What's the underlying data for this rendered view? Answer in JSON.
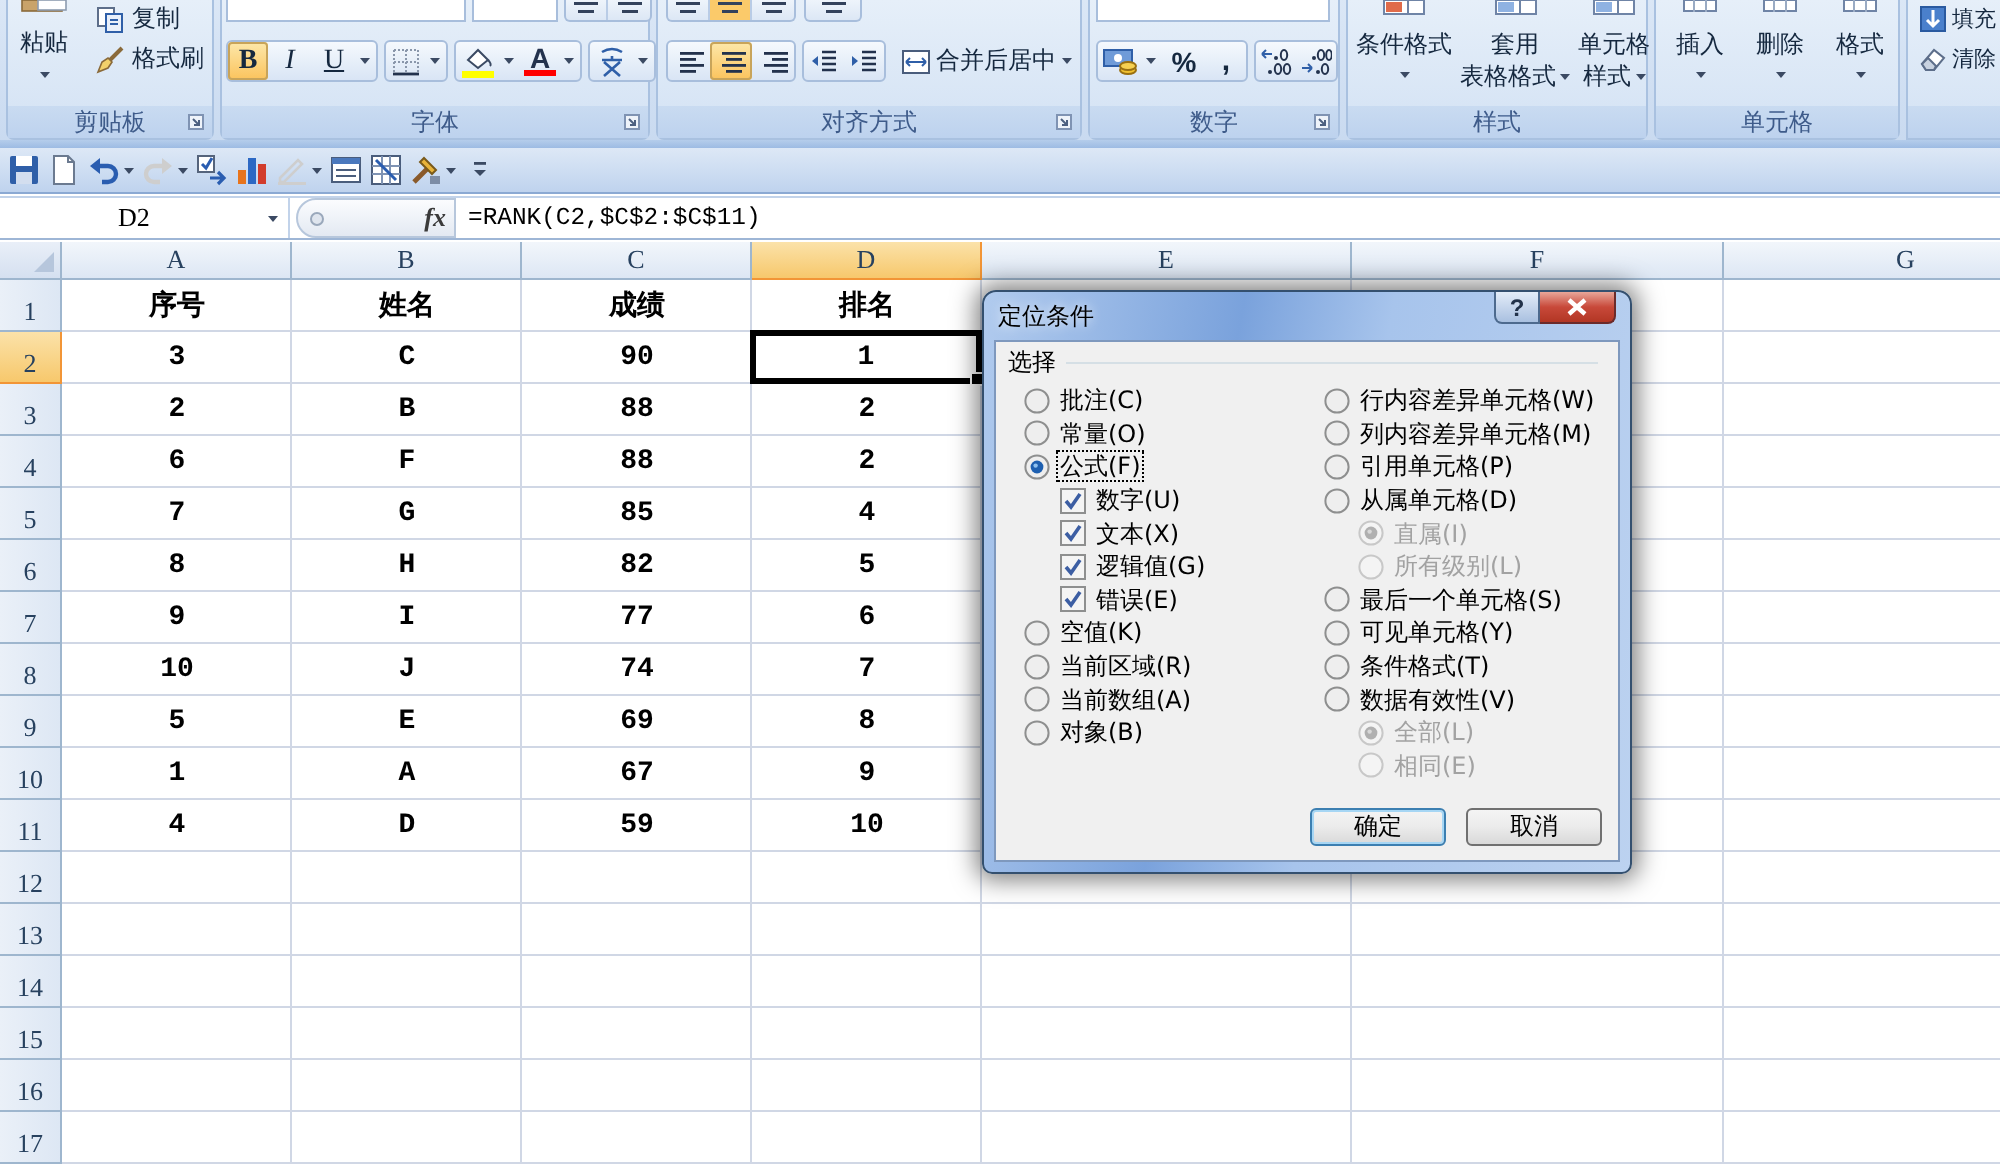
{
  "ribbon": {
    "groups": [
      {
        "kind": "clipboard",
        "label": "剪贴板",
        "paste": "粘贴",
        "copy": "复制",
        "format_painter": "格式刷"
      },
      {
        "kind": "font",
        "label": "字体",
        "buttons": [
          {
            "kind": "bold",
            "text": "B",
            "on": true
          },
          {
            "kind": "italic",
            "text": "I",
            "on": false
          },
          {
            "kind": "underline",
            "text": "U",
            "on": false
          }
        ],
        "font_color": "A"
      },
      {
        "kind": "alignment",
        "label": "对齐方式",
        "vertical": [
          {
            "selected": false
          },
          {
            "selected": true
          },
          {
            "selected": false
          }
        ],
        "horizontal": [
          {
            "kind": "left",
            "selected": false
          },
          {
            "kind": "center",
            "selected": true
          },
          {
            "kind": "right",
            "selected": false
          }
        ],
        "merge": "合并后居中"
      },
      {
        "kind": "number",
        "label": "数字",
        "percent": "%",
        "comma": ","
      },
      {
        "kind": "styles",
        "label": "样式",
        "buttons": [
          {
            "lines": [
              "条件格式"
            ]
          },
          {
            "lines": [
              "套用",
              "表格格式"
            ]
          },
          {
            "lines": [
              "单元格",
              "样式"
            ]
          }
        ]
      },
      {
        "kind": "cells",
        "label": "单元格",
        "buttons": [
          "插入",
          "删除",
          "格式"
        ]
      },
      {
        "kind": "editing",
        "buttons": [
          "填充",
          "清除"
        ]
      }
    ]
  },
  "quick_access": [
    {
      "kind": "save",
      "disabled": false,
      "menu": false
    },
    {
      "kind": "new",
      "disabled": false,
      "menu": false
    },
    {
      "kind": "undo",
      "disabled": false,
      "menu": true
    },
    {
      "kind": "redo",
      "disabled": true,
      "menu": true
    },
    {
      "kind": "check",
      "disabled": false,
      "menu": false
    },
    {
      "kind": "chart",
      "disabled": false,
      "menu": false
    },
    {
      "kind": "pen",
      "disabled": true,
      "menu": true
    },
    {
      "kind": "form",
      "disabled": false,
      "menu": false
    },
    {
      "kind": "grid",
      "disabled": false,
      "menu": false
    },
    {
      "kind": "tools",
      "disabled": false,
      "menu": true
    },
    {
      "kind": "customize",
      "disabled": false,
      "menu": false
    }
  ],
  "formula_bar": {
    "name_box": "D2",
    "fx": "fx",
    "formula": "=RANK(C2,$C$2:$C$11)"
  },
  "sheet": {
    "columns": [
      {
        "label": "A",
        "selected": false
      },
      {
        "label": "B",
        "selected": false
      },
      {
        "label": "C",
        "selected": false
      },
      {
        "label": "D",
        "selected": true
      },
      {
        "label": "E",
        "selected": false
      },
      {
        "label": "F",
        "selected": false
      },
      {
        "label": "G",
        "selected": false
      }
    ],
    "rows": [
      {
        "label": "1",
        "selected": false,
        "cells": [
          "序号",
          "姓名",
          "成绩",
          "排名"
        ]
      },
      {
        "label": "2",
        "selected": true,
        "cells": [
          "3",
          "C",
          "90",
          "1"
        ]
      },
      {
        "label": "3",
        "selected": false,
        "cells": [
          "2",
          "B",
          "88",
          "2"
        ]
      },
      {
        "label": "4",
        "selected": false,
        "cells": [
          "6",
          "F",
          "88",
          "2"
        ]
      },
      {
        "label": "5",
        "selected": false,
        "cells": [
          "7",
          "G",
          "85",
          "4"
        ]
      },
      {
        "label": "6",
        "selected": false,
        "cells": [
          "8",
          "H",
          "82",
          "5"
        ]
      },
      {
        "label": "7",
        "selected": false,
        "cells": [
          "9",
          "I",
          "77",
          "6"
        ]
      },
      {
        "label": "8",
        "selected": false,
        "cells": [
          "10",
          "J",
          "74",
          "7"
        ]
      },
      {
        "label": "9",
        "selected": false,
        "cells": [
          "5",
          "E",
          "69",
          "8"
        ]
      },
      {
        "label": "10",
        "selected": false,
        "cells": [
          "1",
          "A",
          "67",
          "9"
        ]
      },
      {
        "label": "11",
        "selected": false,
        "cells": [
          "4",
          "D",
          "59",
          "10"
        ]
      },
      {
        "label": "12",
        "selected": false
      },
      {
        "label": "13",
        "selected": false
      },
      {
        "label": "14",
        "selected": false
      },
      {
        "label": "15",
        "selected": false
      },
      {
        "label": "16",
        "selected": false
      },
      {
        "label": "17",
        "selected": false
      }
    ]
  },
  "dialog": {
    "title": "定位条件",
    "help": "?",
    "group_label": "选择",
    "left": [
      {
        "kind": "radio",
        "label": "批注(C)",
        "selected": false
      },
      {
        "kind": "radio",
        "label": "常量(O)",
        "selected": false
      },
      {
        "kind": "radio",
        "label": "公式(F)",
        "selected": true,
        "children": [
          {
            "kind": "checkbox",
            "label": "数字(U)",
            "checked": true
          },
          {
            "kind": "checkbox",
            "label": "文本(X)",
            "checked": true
          },
          {
            "kind": "checkbox",
            "label": "逻辑值(G)",
            "checked": true
          },
          {
            "kind": "checkbox",
            "label": "错误(E)",
            "checked": true
          }
        ]
      },
      {
        "kind": "radio",
        "label": "空值(K)",
        "selected": false
      },
      {
        "kind": "radio",
        "label": "当前区域(R)",
        "selected": false
      },
      {
        "kind": "radio",
        "label": "当前数组(A)",
        "selected": false
      },
      {
        "kind": "radio",
        "label": "对象(B)",
        "selected": false
      }
    ],
    "right": [
      {
        "kind": "radio",
        "label": "行内容差异单元格(W)",
        "selected": false
      },
      {
        "kind": "radio",
        "label": "列内容差异单元格(M)",
        "selected": false
      },
      {
        "kind": "radio",
        "label": "引用单元格(P)",
        "selected": false
      },
      {
        "kind": "radio",
        "label": "从属单元格(D)",
        "selected": false,
        "children": [
          {
            "kind": "radio",
            "label": "直属(I)",
            "selected": true,
            "disabled": true
          },
          {
            "kind": "radio",
            "label": "所有级别(L)",
            "selected": false,
            "disabled": true
          }
        ]
      },
      {
        "kind": "radio",
        "label": "最后一个单元格(S)",
        "selected": false
      },
      {
        "kind": "radio",
        "label": "可见单元格(Y)",
        "selected": false
      },
      {
        "kind": "radio",
        "label": "条件格式(T)",
        "selected": false
      },
      {
        "kind": "radio",
        "label": "数据有效性(V)",
        "selected": false,
        "children": [
          {
            "kind": "radio",
            "label": "全部(L)",
            "selected": true,
            "disabled": true
          },
          {
            "kind": "radio",
            "label": "相同(E)",
            "selected": false,
            "disabled": true
          }
        ]
      }
    ],
    "buttons": [
      {
        "label": "确定",
        "default": true
      },
      {
        "label": "取消",
        "default": false
      }
    ]
  }
}
